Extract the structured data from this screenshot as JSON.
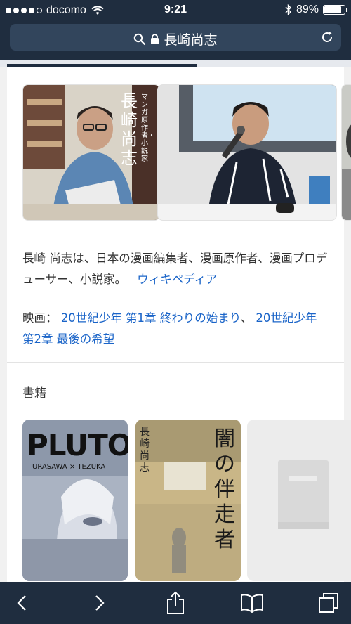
{
  "status_bar": {
    "carrier": "docomo",
    "time": "9:21",
    "battery_percent": "89%",
    "battery_level": 0.89
  },
  "url_bar": {
    "query": "長崎尚志"
  },
  "knowledge": {
    "description": "長崎 尚志は、日本の漫画編集者、漫画原作者、漫画プロデューサー、小説家。",
    "source_link": "ウィキペディア",
    "film_label": "映画：",
    "films": [
      "20世紀少年 第1章 終わりの始まり",
      "20世紀少年 第2章 最後の希望"
    ],
    "film_separator": "、",
    "books_heading": "書籍"
  },
  "photos": {
    "photo1_vertical_text": "長崎尚志",
    "photo1_side_text": "マンガ原作者・小説家"
  },
  "books": {
    "book1_title": "PLUTO",
    "book1_subtitle": "URASAWA × TEZUKA",
    "book2_title": "闇の伴走者",
    "book2_author": "長崎尚志"
  }
}
